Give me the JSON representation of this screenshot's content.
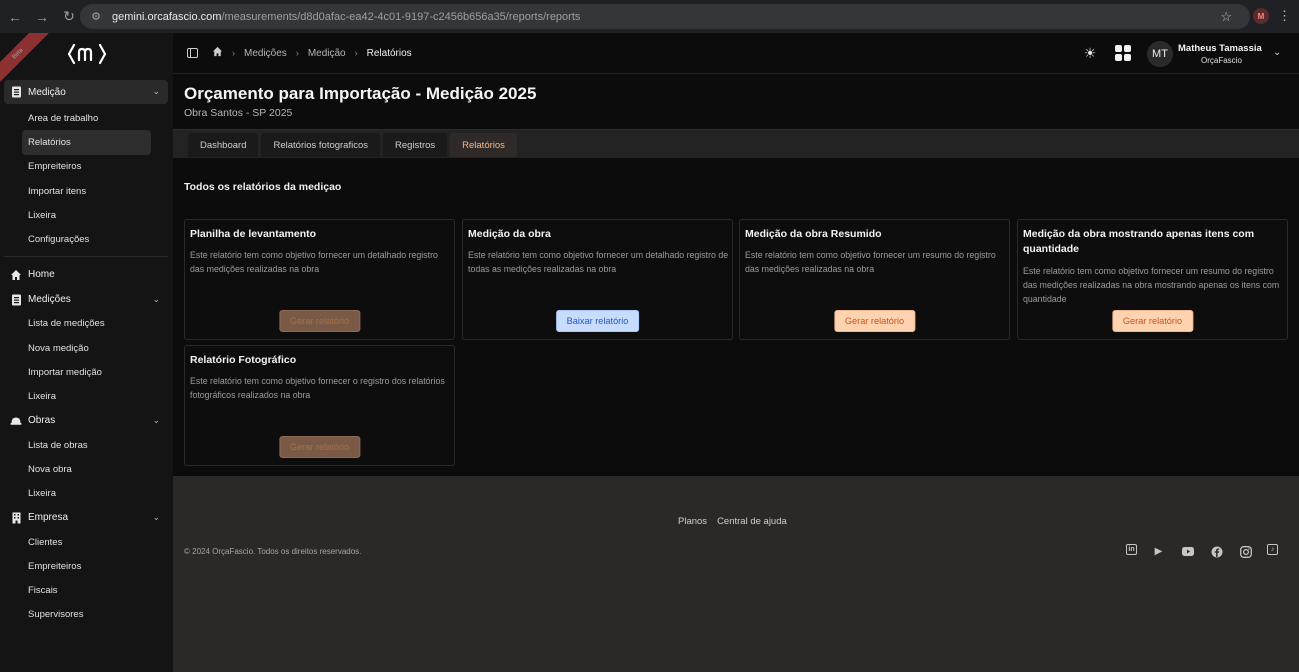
{
  "browser": {
    "url_host": "gemini.orcafascio.com",
    "url_path": "/measurements/d8d0afac-ea42-4c01-9197-c2456b656a35/reports/reports",
    "profile_initial": "M"
  },
  "sidebar": {
    "ribbon_text": "Beta",
    "medicao_group": {
      "label": "Medição",
      "items": [
        "Area de trabalho",
        "Relatórios",
        "Empreiteiros",
        "Importar itens",
        "Lixeira",
        "Configurações"
      ]
    },
    "home_label": "Home",
    "medicoes_group": {
      "label": "Medições",
      "items": [
        "Lista de medições",
        "Nova medição",
        "Importar medição",
        "Lixeira"
      ]
    },
    "obras_group": {
      "label": "Obras",
      "items": [
        "Lista de obras",
        "Nova obra",
        "Lixeira"
      ]
    },
    "empresa_group": {
      "label": "Empresa",
      "items": [
        "Clientes",
        "Empreiteiros",
        "Fiscais",
        "Supervisores"
      ]
    }
  },
  "topbar": {
    "breadcrumbs": [
      "Medições",
      "Medição",
      "Relatórios"
    ],
    "user_initials": "MT",
    "user_name": "Matheus Tamassia",
    "user_org": "OrçaFascio"
  },
  "page": {
    "title": "Orçamento para Importação - Medição 2025",
    "subtitle": "Obra Santos - SP 2025",
    "tabs": [
      "Dashboard",
      "Relatórios fotograficos",
      "Registros",
      "Relatórios"
    ],
    "active_tab": "Relatórios",
    "section_title": "Todos os relatórios da mediçao"
  },
  "cards": [
    {
      "title": "Planilha de levantamento",
      "description": "Este relatório tem como objetivo fornecer um detalhado registro das medições realizadas na obra",
      "button": "Gerar relatório",
      "button_state": "disabled"
    },
    {
      "title": "Medição da obra",
      "description": "Este relatório tem como objetivo fornecer um detalhado registro de todas as medições realizadas na obra",
      "button": "Baixar relatório",
      "button_state": "download"
    },
    {
      "title": "Medição da obra Resumido",
      "description": "Este relatório tem como objetivo fornecer um resumo do registro das medições realizadas na obra",
      "button": "Gerar relatório",
      "button_state": "enabled"
    },
    {
      "title": "Medição da obra mostrando apenas itens com quantidade",
      "description": "Este relatório tem como objetivo fornecer um resumo do registro das medições realizadas na obra mostrando apenas os itens com quantidade",
      "button": "Gerar relatório",
      "button_state": "enabled"
    },
    {
      "title": "Relatório Fotográfico",
      "description": "Este relatório tem como objetivo fornecer o registro dos relatórios fotográficos realizados na obra",
      "button": "Gerar relatório",
      "button_state": "disabled"
    }
  ],
  "footer": {
    "links": [
      "Planos",
      "Central de ajuda"
    ],
    "copyright": "© 2024 OrçaFascio. Todos os direitos reservados.",
    "socials": [
      "linkedin-icon",
      "podcast-icon",
      "youtube-icon",
      "facebook-icon",
      "instagram-icon",
      "tiktok-icon"
    ]
  },
  "colors": {
    "accent": "#f0b890",
    "button_orange_bg": "#ffd3b0",
    "button_blue_bg": "#c7dcff"
  }
}
